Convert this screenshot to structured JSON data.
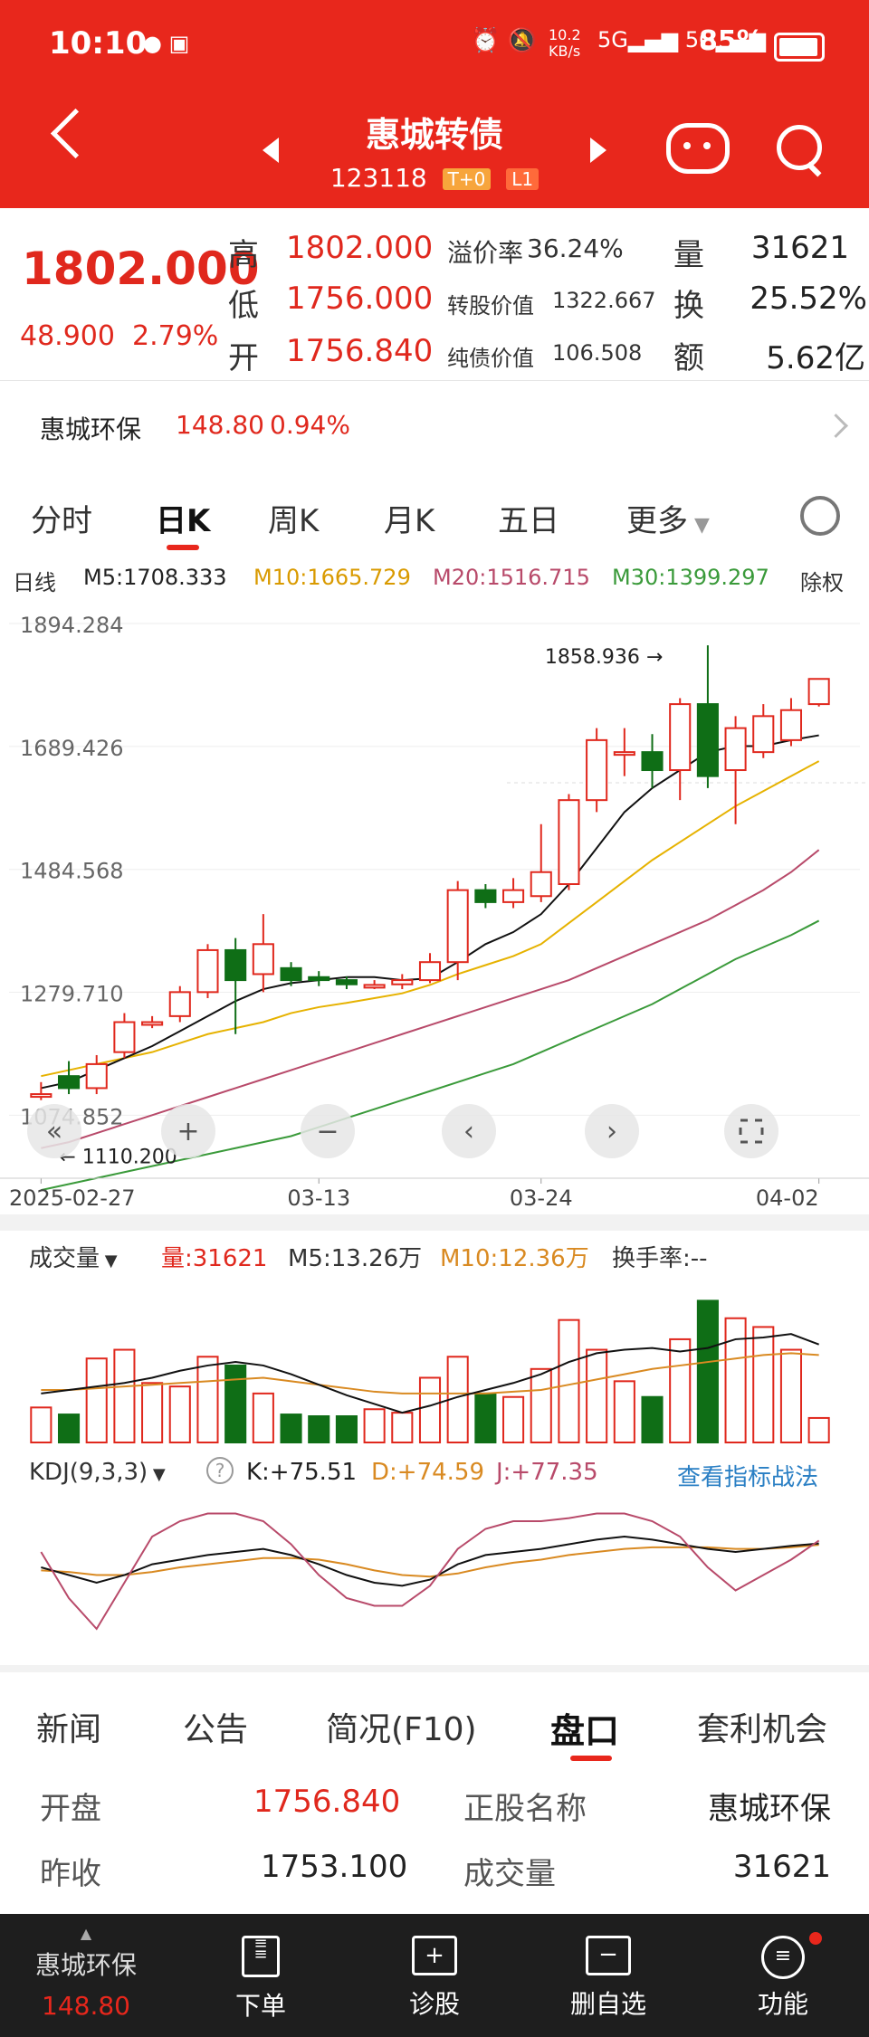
{
  "status_bar": {
    "time": "10:10",
    "net_speed": "10.2 KB/s",
    "battery": "85%"
  },
  "header": {
    "title": "惠城转债",
    "code": "123118",
    "tag1": "T+0",
    "tag2": "L1"
  },
  "quote": {
    "price": "1802.000",
    "change": "48.900",
    "change_pct": "2.79%",
    "high_label": "高",
    "high": "1802.000",
    "low_label": "低",
    "low": "1756.000",
    "open_label": "开",
    "open": "1756.840",
    "premium_label": "溢价率",
    "premium": "36.24%",
    "conv_label": "转股价值",
    "conv": "1322.667",
    "bond_label": "纯债价值",
    "bond": "106.508",
    "vol_label": "量",
    "vol": "31621",
    "turnover_label": "换",
    "turnover": "25.52%",
    "amount_label": "额",
    "amount": "5.62亿"
  },
  "underlying": {
    "name": "惠城环保",
    "price": "148.80",
    "pct": "0.94%"
  },
  "chart_tabs": [
    "分时",
    "日K",
    "周K",
    "月K",
    "五日",
    "更多"
  ],
  "active_tab": "日K",
  "ma_legend": {
    "label": "日线",
    "m5": "M5:1708.333",
    "m10": "M10:1665.729",
    "m20": "M20:1516.715",
    "m30": "M30:1399.297",
    "adj": "除权"
  },
  "volume_legend": {
    "label": "成交量",
    "vol": "量:31621",
    "m5": "M5:13.26万",
    "m10": "M10:12.36万",
    "turn": "换手率:--"
  },
  "kdj_legend": {
    "label": "KDJ(9,3,3)",
    "k": "K:+75.51",
    "d": "D:+74.59",
    "j": "J:+77.35",
    "link": "查看指标战法"
  },
  "chart_data": {
    "type": "candlestick",
    "y_ticks": [
      "1894.284",
      "1689.426",
      "1484.568",
      "1279.710",
      "1074.852"
    ],
    "x_ticks": [
      "2025-02-27",
      "03-13",
      "03-24",
      "04-02"
    ],
    "annotations": {
      "high": "1858.936",
      "low": "1110.200"
    },
    "candles": [
      {
        "o": 1110,
        "c": 1110,
        "h": 1130,
        "l": 1100,
        "v": 2.0
      },
      {
        "o": 1140,
        "c": 1120,
        "h": 1165,
        "l": 1110,
        "v": 1.6
      },
      {
        "o": 1120,
        "c": 1160,
        "h": 1175,
        "l": 1110,
        "v": 4.8
      },
      {
        "o": 1180,
        "c": 1230,
        "h": 1245,
        "l": 1170,
        "v": 5.3
      },
      {
        "o": 1230,
        "c": 1230,
        "h": 1240,
        "l": 1220,
        "v": 3.4
      },
      {
        "o": 1240,
        "c": 1280,
        "h": 1290,
        "l": 1230,
        "v": 3.2
      },
      {
        "o": 1280,
        "c": 1350,
        "h": 1360,
        "l": 1270,
        "v": 4.9
      },
      {
        "o": 1350,
        "c": 1300,
        "h": 1370,
        "l": 1210,
        "v": 4.4
      },
      {
        "o": 1310,
        "c": 1360,
        "h": 1410,
        "l": 1280,
        "v": 2.8
      },
      {
        "o": 1320,
        "c": 1300,
        "h": 1330,
        "l": 1290,
        "v": 1.6
      },
      {
        "o": 1305,
        "c": 1300,
        "h": 1315,
        "l": 1290,
        "v": 1.5
      },
      {
        "o": 1300,
        "c": 1293,
        "h": 1306,
        "l": 1285,
        "v": 1.5
      },
      {
        "o": 1290,
        "c": 1292,
        "h": 1300,
        "l": 1285,
        "v": 1.9
      },
      {
        "o": 1293,
        "c": 1300,
        "h": 1310,
        "l": 1285,
        "v": 1.7
      },
      {
        "o": 1300,
        "c": 1330,
        "h": 1345,
        "l": 1295,
        "v": 3.7
      },
      {
        "o": 1330,
        "c": 1450,
        "h": 1465,
        "l": 1300,
        "v": 4.9
      },
      {
        "o": 1450,
        "c": 1430,
        "h": 1460,
        "l": 1420,
        "v": 2.8
      },
      {
        "o": 1430,
        "c": 1450,
        "h": 1470,
        "l": 1420,
        "v": 2.6
      },
      {
        "o": 1440,
        "c": 1480,
        "h": 1560,
        "l": 1430,
        "v": 4.2
      },
      {
        "o": 1460,
        "c": 1600,
        "h": 1610,
        "l": 1450,
        "v": 7.0
      },
      {
        "o": 1600,
        "c": 1700,
        "h": 1720,
        "l": 1580,
        "v": 5.3
      },
      {
        "o": 1680,
        "c": 1680,
        "h": 1720,
        "l": 1640,
        "v": 3.5
      },
      {
        "o": 1680,
        "c": 1650,
        "h": 1710,
        "l": 1620,
        "v": 2.6
      },
      {
        "o": 1650,
        "c": 1760,
        "h": 1770,
        "l": 1600,
        "v": 5.9
      },
      {
        "o": 1760,
        "c": 1640,
        "h": 1858,
        "l": 1620,
        "v": 8.1
      },
      {
        "o": 1650,
        "c": 1720,
        "h": 1740,
        "l": 1560,
        "v": 7.1
      },
      {
        "o": 1680,
        "c": 1740,
        "h": 1760,
        "l": 1670,
        "v": 6.6
      },
      {
        "o": 1700,
        "c": 1750,
        "h": 1770,
        "l": 1690,
        "v": 5.3
      },
      {
        "o": 1760,
        "c": 1802,
        "h": 1802,
        "l": 1756,
        "v": 1.4
      }
    ],
    "volume_ma5": [
      2.8,
      3.0,
      3.2,
      3.4,
      3.7,
      4.1,
      4.4,
      4.6,
      4.4,
      3.9,
      3.3,
      2.7,
      2.2,
      1.7,
      2.1,
      2.6,
      3.0,
      3.4,
      3.9,
      4.6,
      5.1,
      5.3,
      5.4,
      5.2,
      5.4,
      5.9,
      6.0,
      6.2,
      5.6
    ],
    "volume_ma10": [
      3.0,
      3.0,
      3.1,
      3.2,
      3.3,
      3.4,
      3.5,
      3.6,
      3.7,
      3.5,
      3.3,
      3.1,
      2.9,
      2.8,
      2.8,
      2.8,
      2.8,
      2.9,
      3.0,
      3.3,
      3.6,
      3.9,
      4.2,
      4.4,
      4.6,
      4.8,
      5.0,
      5.1,
      5.0
    ],
    "ma10": [
      1140,
      1150,
      1160,
      1170,
      1180,
      1195,
      1210,
      1220,
      1230,
      1245,
      1255,
      1262,
      1270,
      1278,
      1292,
      1310,
      1325,
      1340,
      1360,
      1395,
      1430,
      1465,
      1500,
      1530,
      1560,
      1590,
      1615,
      1640,
      1665
    ],
    "ma5": [
      1120,
      1130,
      1150,
      1170,
      1190,
      1215,
      1240,
      1265,
      1285,
      1295,
      1300,
      1305,
      1305,
      1300,
      1303,
      1330,
      1360,
      1380,
      1410,
      1460,
      1520,
      1580,
      1620,
      1650,
      1680,
      1690,
      1690,
      1700,
      1708
    ],
    "ma20": [
      1020,
      1030,
      1045,
      1060,
      1075,
      1090,
      1105,
      1120,
      1135,
      1150,
      1165,
      1180,
      1195,
      1210,
      1225,
      1240,
      1255,
      1270,
      1285,
      1300,
      1320,
      1340,
      1360,
      1380,
      1400,
      1425,
      1450,
      1480,
      1517
    ],
    "ma30": [
      950,
      960,
      970,
      980,
      990,
      1000,
      1010,
      1020,
      1030,
      1040,
      1055,
      1070,
      1085,
      1100,
      1115,
      1130,
      1145,
      1160,
      1180,
      1200,
      1220,
      1240,
      1260,
      1285,
      1310,
      1335,
      1355,
      1375,
      1399
    ],
    "k": [
      60,
      55,
      50,
      55,
      62,
      65,
      68,
      70,
      72,
      68,
      62,
      55,
      50,
      48,
      52,
      62,
      68,
      70,
      72,
      75,
      78,
      80,
      78,
      75,
      72,
      70,
      72,
      74,
      75.5
    ],
    "d": [
      58,
      57,
      55,
      55,
      57,
      60,
      62,
      64,
      66,
      66,
      65,
      62,
      58,
      55,
      54,
      56,
      60,
      63,
      65,
      68,
      70,
      72,
      73,
      73,
      73,
      72,
      72,
      73,
      74.6
    ],
    "j": [
      70,
      40,
      20,
      50,
      80,
      90,
      95,
      95,
      90,
      75,
      55,
      40,
      35,
      35,
      48,
      72,
      85,
      90,
      90,
      92,
      95,
      95,
      90,
      80,
      60,
      45,
      55,
      65,
      77.4
    ]
  },
  "bottom_tabs": [
    "新闻",
    "公告",
    "简况(F10)",
    "盘口",
    "套利机会"
  ],
  "active_bottom_tab": "盘口",
  "info": {
    "open_label": "开盘",
    "open": "1756.840",
    "stock_label": "正股名称",
    "stock": "惠城环保",
    "prev_label": "昨收",
    "prev": "1753.100",
    "vol_label": "成交量",
    "vol": "31621"
  },
  "nav": {
    "stock": "惠城环保",
    "price": "148.80",
    "order": "下单",
    "diag": "诊股",
    "remove": "删自选",
    "func": "功能"
  }
}
